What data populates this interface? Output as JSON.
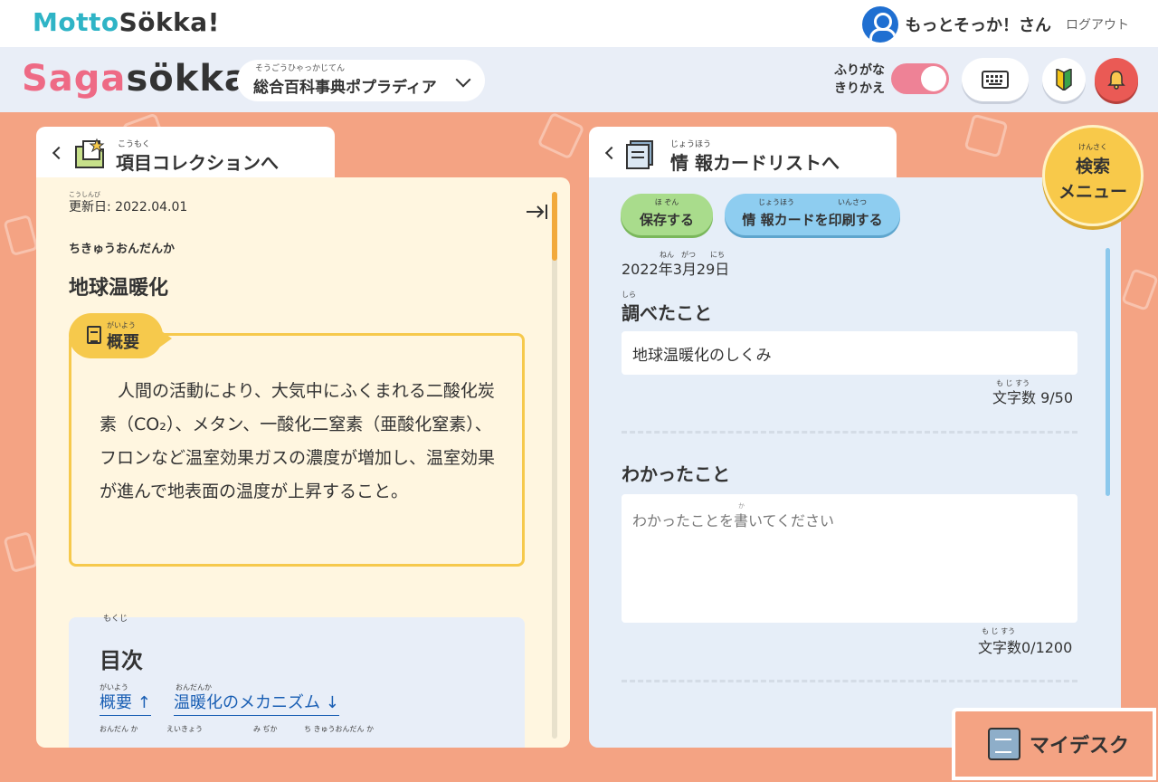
{
  "header": {
    "brand_left": "Motto",
    "brand_right": "Sökka!",
    "user_name": "もっとそっか！さん",
    "logout": "ログアウト"
  },
  "subheader": {
    "brand_left": "Saga",
    "brand_right": "sökka!",
    "dictionary_ruby": "そうごうひゃっかじてん",
    "dictionary": "総合百科事典ポプラディア",
    "furigana_toggle_line1": "ふりがな",
    "furigana_toggle_line2": "きりかえ",
    "furigana_on": true
  },
  "left_panel": {
    "back_ruby": "こうもく",
    "back_label": "項目コレクションへ",
    "update_ruby": "こうしんび",
    "update_label": "更新日: 2022.04.01",
    "reading": "ちきゅうおんだんか",
    "title": "地球温暖化",
    "summary_ruby": "がいよう",
    "summary_label": "概要",
    "summary_text": "人間の活動により、大気中にふくまれる二酸化炭素（CO₂）、メタン、一酸化二窒素（亜酸化窒素）、フロンなど温室効果ガスの濃度が増加し、温室効果が進んで地表面の温度が上昇すること。",
    "toc_ruby": "もくじ",
    "toc_title": "目次",
    "toc_links": [
      {
        "ruby": "がいよう",
        "label": "概要 ↑"
      },
      {
        "ruby": "おんだんか",
        "label": "温暖化のメカニズム ↓"
      }
    ],
    "toc_more_rubies": [
      "おんだん か",
      "えいきょう",
      "み ぢか",
      "ち きゅうおんだん か"
    ]
  },
  "right_panel": {
    "back_ruby": "じょうほう",
    "back_label": "情 報カードリストへ",
    "save_ruby": "ほ ぞん",
    "save_label": "保存する",
    "print_ruby": "じょうほう　　　　　　いんさつ",
    "print_label": "情 報カードを印刷する",
    "date_ruby": "ねん　がつ　　にち",
    "date": "2022年3月29日",
    "researched_ruby": "しら",
    "researched_label": "調べたこと",
    "researched_value": "地球温暖化のしくみ",
    "count_ruby": "も じ すう",
    "researched_count": "文字数 9/50",
    "learned_label": "わかったこと",
    "learned_placeholder_ruby": "か",
    "learned_placeholder": "わかったことを書いてください",
    "learned_count": "文字数0/1200"
  },
  "search_menu": {
    "ruby": "けんさく",
    "line1": "検索",
    "line2": "メニュー"
  },
  "mydesk": {
    "label": "マイデスク"
  },
  "colors": {
    "background": "#f4a383",
    "accent_teal": "#2fb4c6",
    "accent_pink": "#ee6a85",
    "summary_border": "#f6c94c",
    "save_green": "#a9dc8c",
    "print_blue": "#8ecdf0",
    "link_blue": "#1a5fb4"
  }
}
